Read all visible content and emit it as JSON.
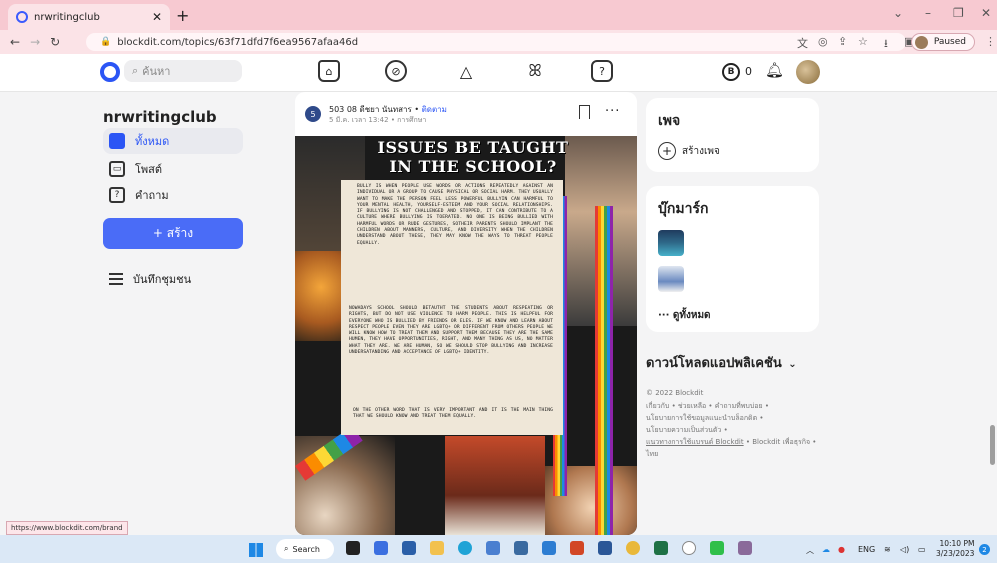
{
  "browser": {
    "tab_title": "nrwritingclub",
    "tab_close": "✕",
    "new_tab": "+",
    "url": "blockdit.com/topics/63f71dfd7f6ea9567afaa46d",
    "profile_status": "Paused",
    "status_url": "https://www.blockdit.com/brand"
  },
  "header": {
    "search_placeholder": "ค้นหา",
    "coin_symbol": "B",
    "coin_count": "0"
  },
  "sidebar": {
    "title": "nrwritingclub",
    "items": [
      {
        "label": "ทั้งหมด",
        "icon": "home-icon"
      },
      {
        "label": "โพสต์",
        "icon": "post-icon"
      },
      {
        "label": "คำถาม",
        "icon": "question-icon"
      }
    ],
    "create_label": "+ สร้าง",
    "notes_label": "บันทึกชุมชน"
  },
  "post": {
    "avatar_text": "5",
    "author": "503 08 ดีชยา นันทสาร",
    "follow": "ติดตาม",
    "meta": "5 มี.ค. เวลา 13:42 • การศึกษา",
    "more": "···",
    "poster_title": "ISSUES BE TAUGHT IN THE SCHOOL?",
    "paragraph_1": "BULLY IS WHEN PEOPLE USE WORDS OR ACTIONS REPEATEDLY AGAINST AN INDIVIDUAL OR A GROUP TO CAUSE PHYSICAL OR SOCIAL HARM. THEY USUALLY WANT TO MAKE THE PERSON FEEL LESS POWERFUL BULLYIN CAN HARMFUL TO YOUR MENTAL HEALTH, YOURSELF-ESTEEM AND YOUR SOCIAL RELATIONSHIPS. IF BULLYING IS NOT CHALLENGED AND STOPPED, IT CAN CONTRIBUTE TO A CULTURE WHERE BULLYING IS TOERATED. NO ONE IS BEING BULLIED WITH HARMFUL WORDS OR RUDE GESTURES, SOTHEIR PARENTS SHOULD IMPLANT THE CHILDREN ABOUT MANNERS, CULTURE, AND DIVERSITY WHEN THE CHILDREN UNDERSTAND ABOUT THESE, THEY MAY KNOW THE WAYS TO THREAT PEOPLE EQUALLY.",
    "paragraph_2": "NOWADAYS SCHOOL SHOULD BETAUTHT THE STUDENTS ABOUT RESPEATING OR RIGHTS, BUT DO NOT USE VIOLENCE TO HARM PEOPLE. THIS IS HELPFUL FOR EVERYONE WHO IS BULLIED BY FRIENDS OR ELES. IF WE KNOW AND LEARN ABOUT RESPECT PEOPLE EVEN THEY ARE LGBTQ+ OR DIFFERENT FROM OTHERS PEOPLE WE WILL KNOW HOW TO TREAT THEM AND SUPPORT THEM BECAUSE THEY ARE THE SAME HUMEN, THEY HAVE OPPORTUNITIES, RIGHT, AND MANY THING AS US, NO MATTER WHAT THEY ARE. WE ARE HUMAN, SO WE SHOULD STOP BULLYING AND INCREASE UNDERSATANDING AND ACCEPTANCE OF LGBTQ+ IDENTITY.",
    "paragraph_3": "ON THE OTHER WORD THAT IS VERY IMPORTANT AND IT IS THE MAIN THING THAT WE SHOULD KNOW AND TREAT THEM EQUALLY."
  },
  "right": {
    "pages_title": "เพจ",
    "create_page": "สร้างเพจ",
    "bookmarks_title": "บุ๊กมาร์ก",
    "see_all": "··· ดูทั้งหมด",
    "download_apps": "ดาวน์โหลดแอปพลิเคชัน",
    "copyright": "© 2022 Blockdit",
    "footer_1": "เกี่ยวกับ • ช่วยเหลือ • คำถามที่พบบ่อย •",
    "footer_2": "นโยบายการใช้ขอมูลแนะนำบล็อกดิต •",
    "footer_3": "นโยบายความเป็นส่วนตัว •",
    "footer_link": "แนวทางการใช้แบรนด์ Blockdit",
    "footer_4": " • Blockdit เพื่อธุรกิจ •",
    "footer_5": "ไทย"
  },
  "taskbar": {
    "search_label": "Search",
    "lang": "ENG",
    "time": "10:10 PM",
    "date": "3/23/2023",
    "notif_count": "2"
  },
  "colors": {
    "accent": "#2b55f5",
    "create_button": "#4a6cf7",
    "tabbar": "#f7c9d1"
  }
}
